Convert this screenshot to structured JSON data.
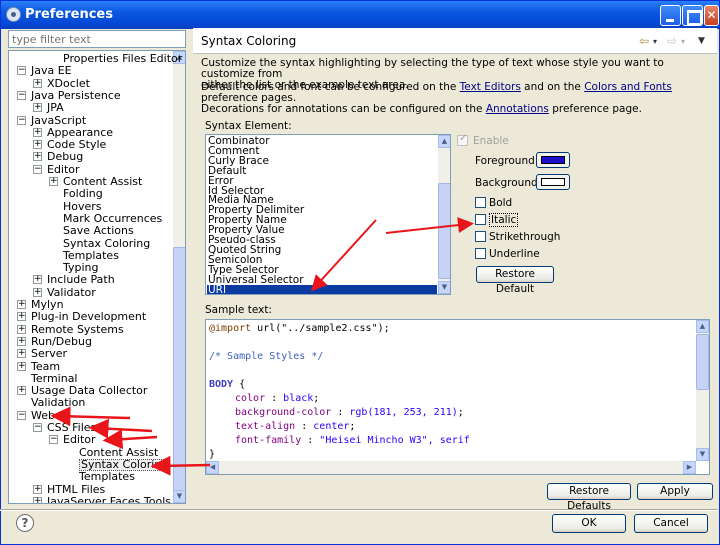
{
  "window": {
    "title": "Preferences"
  },
  "filter": {
    "placeholder": "type filter text"
  },
  "tree": [
    {
      "label": "Properties Files Editor",
      "level": 2,
      "twisty": ""
    },
    {
      "label": "Java EE",
      "level": 0,
      "twisty": "-"
    },
    {
      "label": "XDoclet",
      "level": 1,
      "twisty": "+"
    },
    {
      "label": "Java Persistence",
      "level": 0,
      "twisty": "-"
    },
    {
      "label": "JPA",
      "level": 1,
      "twisty": "+"
    },
    {
      "label": "JavaScript",
      "level": 0,
      "twisty": "-"
    },
    {
      "label": "Appearance",
      "level": 1,
      "twisty": "+"
    },
    {
      "label": "Code Style",
      "level": 1,
      "twisty": "+"
    },
    {
      "label": "Debug",
      "level": 1,
      "twisty": "+"
    },
    {
      "label": "Editor",
      "level": 1,
      "twisty": "-"
    },
    {
      "label": "Content Assist",
      "level": 2,
      "twisty": "+"
    },
    {
      "label": "Folding",
      "level": 2,
      "twisty": ""
    },
    {
      "label": "Hovers",
      "level": 2,
      "twisty": ""
    },
    {
      "label": "Mark Occurrences",
      "level": 2,
      "twisty": ""
    },
    {
      "label": "Save Actions",
      "level": 2,
      "twisty": ""
    },
    {
      "label": "Syntax Coloring",
      "level": 2,
      "twisty": ""
    },
    {
      "label": "Templates",
      "level": 2,
      "twisty": ""
    },
    {
      "label": "Typing",
      "level": 2,
      "twisty": ""
    },
    {
      "label": "Include Path",
      "level": 1,
      "twisty": "+"
    },
    {
      "label": "Validator",
      "level": 1,
      "twisty": "+"
    },
    {
      "label": "Mylyn",
      "level": 0,
      "twisty": "+"
    },
    {
      "label": "Plug-in Development",
      "level": 0,
      "twisty": "+"
    },
    {
      "label": "Remote Systems",
      "level": 0,
      "twisty": "+"
    },
    {
      "label": "Run/Debug",
      "level": 0,
      "twisty": "+"
    },
    {
      "label": "Server",
      "level": 0,
      "twisty": "+"
    },
    {
      "label": "Team",
      "level": 0,
      "twisty": "+"
    },
    {
      "label": "Terminal",
      "level": 0,
      "twisty": ""
    },
    {
      "label": "Usage Data Collector",
      "level": 0,
      "twisty": "+"
    },
    {
      "label": "Validation",
      "level": 0,
      "twisty": ""
    },
    {
      "label": "Web",
      "level": 0,
      "twisty": "-"
    },
    {
      "label": "CSS Files",
      "level": 1,
      "twisty": "-"
    },
    {
      "label": "Editor",
      "level": 2,
      "twisty": "-"
    },
    {
      "label": "Content Assist",
      "level": 3,
      "twisty": ""
    },
    {
      "label": "Syntax Coloring",
      "level": 3,
      "twisty": "",
      "selected": true
    },
    {
      "label": "Templates",
      "level": 3,
      "twisty": ""
    },
    {
      "label": "HTML Files",
      "level": 1,
      "twisty": "+"
    },
    {
      "label": "JavaServer Faces Tools",
      "level": 1,
      "twisty": "+"
    }
  ],
  "page": {
    "title": "Syntax Coloring",
    "desc1_line1": "Customize the syntax highlighting by selecting the type of text whose style you want to customize from",
    "desc1_line2": "either the list or the example text area.",
    "desc2_pre": "Default colors and font can be configured on the ",
    "desc2_link1": "Text Editors",
    "desc2_mid": " and on the ",
    "desc2_link2": "Colors and Fonts",
    "desc2_post": " preference pages.",
    "desc3_pre": "Decorations for annotations can be configured on the ",
    "desc3_link": "Annotations",
    "desc3_post": " preference page.",
    "syntax_label": "Syntax Element:",
    "elements": [
      "Combinator",
      "Comment",
      "Curly Brace",
      "Default",
      "Error",
      "Id Selector",
      "Media Name",
      "Property Delimiter",
      "Property Name",
      "Property Value",
      "Pseudo-class",
      "Quoted String",
      "Semicolon",
      "Type Selector",
      "Universal Selector",
      "URI"
    ],
    "enable_label": "Enable",
    "foreground_label": "Foreground:",
    "background_label": "Background:",
    "foreground_color": "#1a10c8",
    "background_color": "#ffffff",
    "bold_label": "Bold",
    "italic_label": "Italic",
    "strike_label": "Strikethrough",
    "underline_label": "Underline",
    "restore_default": "Restore Default",
    "sample_label": "Sample text:",
    "restore_defaults": "Restore Defaults",
    "apply": "Apply"
  },
  "sample_code": {
    "l1_kw": "@import",
    "l1_rest": " url(\"../sample2.css\");",
    "l2": "/* Sample Styles */",
    "l3_sel": "BODY",
    "l3_rest": " {",
    "l4_prop": "color",
    "l4_sep": " : ",
    "l4_val": "black",
    "l5_prop": "background-color",
    "l5_sep": " : ",
    "l5_val": "rgb(181, 253, 211)",
    "l6_prop": "text-align",
    "l6_sep": " : ",
    "l6_val": "center",
    "l7_prop": "font-family",
    "l7_sep": " : ",
    "l7_val": "\"Heisei Mincho W3\", serif",
    "l8": "}"
  },
  "footer": {
    "ok": "OK",
    "cancel": "Cancel",
    "help_symbol": "?"
  },
  "icons": {
    "back": "back-arrow-icon",
    "forward": "forward-arrow-icon",
    "menu": "view-menu-icon"
  }
}
